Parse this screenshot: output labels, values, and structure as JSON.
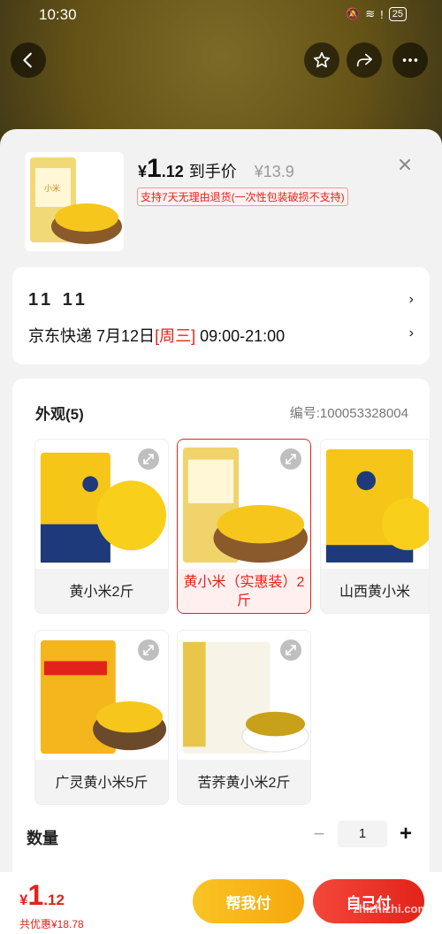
{
  "status": {
    "time": "10:30",
    "battery": "25"
  },
  "product": {
    "price_yen": "¥",
    "price_int": "1",
    "price_dec": ".12",
    "price_label": "到手价",
    "orig_price": "¥13.9",
    "return_policy": "支持7天无理由退货(一次性包装破损不支持)"
  },
  "shipping": {
    "promo": "11 11",
    "carrier": "京东快递",
    "date": "7月12日",
    "weekday": "[周三]",
    "window": "09:00-21:00"
  },
  "options": {
    "title": "外观(5)",
    "code": "编号:100053328004",
    "items": [
      {
        "label": "黄小米2斤",
        "selected": false
      },
      {
        "label": "黄小米（实惠装）2斤",
        "selected": true
      },
      {
        "label": "山西黄小米",
        "selected": false
      },
      {
        "label": "广灵黄小米5斤",
        "selected": false
      },
      {
        "label": "苦荞黄小米2斤",
        "selected": false
      }
    ]
  },
  "quantity": {
    "label": "数量",
    "value": "1"
  },
  "footer": {
    "yen": "¥",
    "int": "1",
    "dec": ".12",
    "saving": "共优惠¥18.78",
    "help_pay": "帮我付",
    "self_pay": "自己付",
    "watermark": "zhizhizhi.com"
  },
  "colors": {
    "accent_red": "#e2231a",
    "accent_yellow": "#f6a80e"
  }
}
